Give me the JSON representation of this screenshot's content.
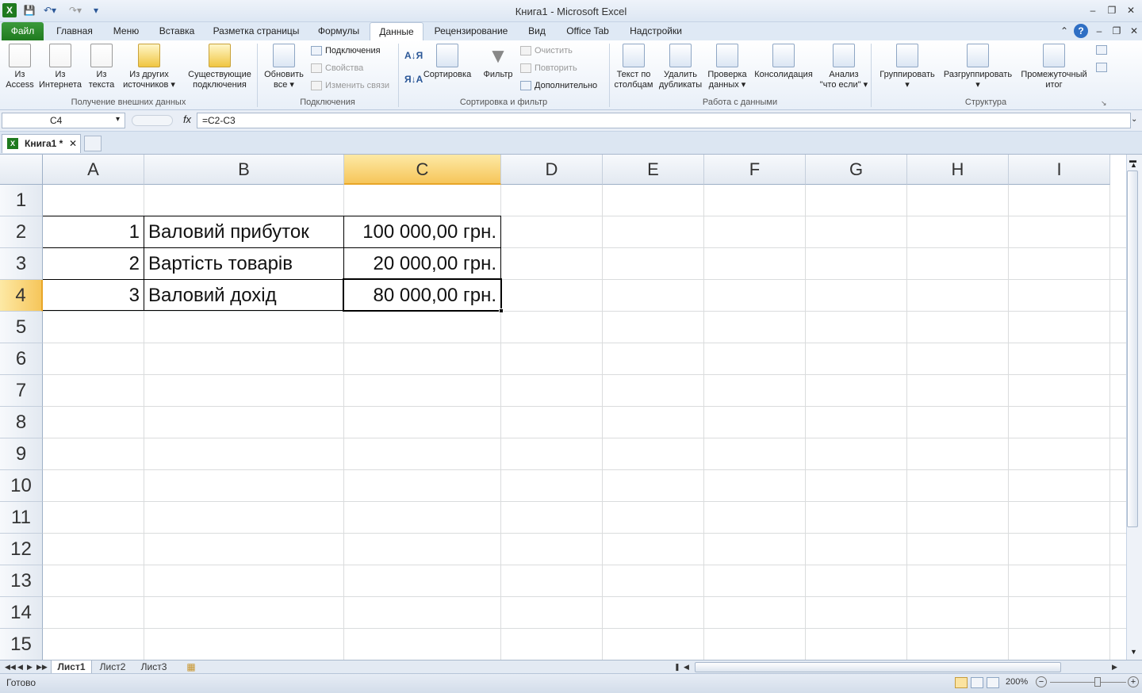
{
  "window": {
    "title": "Книга1  -  Microsoft Excel"
  },
  "ribbon_tabs": [
    "Файл",
    "Главная",
    "Меню",
    "Вставка",
    "Разметка страницы",
    "Формулы",
    "Данные",
    "Рецензирование",
    "Вид",
    "Office Tab",
    "Надстройки"
  ],
  "ribbon": {
    "get_external": {
      "label": "Получение внешних данных",
      "from_access": [
        "Из",
        "Access"
      ],
      "from_web": [
        "Из",
        "Интернета"
      ],
      "from_text": [
        "Из",
        "текста"
      ],
      "from_other": [
        "Из других",
        "источников"
      ],
      "existing": [
        "Существующие",
        "подключения"
      ]
    },
    "connections": {
      "label": "Подключения",
      "refresh": [
        "Обновить",
        "все"
      ],
      "connections_btn": "Подключения",
      "properties": "Свойства",
      "edit_links": "Изменить связи"
    },
    "sort_filter": {
      "label": "Сортировка и фильтр",
      "sort": "Сортировка",
      "filter": "Фильтр",
      "clear": "Очистить",
      "reapply": "Повторить",
      "advanced": "Дополнительно"
    },
    "data_tools": {
      "label": "Работа с данными",
      "text_to_cols": [
        "Текст по",
        "столбцам"
      ],
      "remove_dup": [
        "Удалить",
        "дубликаты"
      ],
      "validation": [
        "Проверка",
        "данных"
      ],
      "consolidate": "Консолидация",
      "what_if": [
        "Анализ",
        "\"что если\""
      ]
    },
    "outline": {
      "label": "Структура",
      "group": "Группировать",
      "ungroup": "Разгруппировать",
      "subtotal": [
        "Промежуточный",
        "итог"
      ]
    }
  },
  "formula_bar": {
    "name_box": "C4",
    "fx": "fx",
    "formula": "=C2-C3"
  },
  "doc_tab": {
    "label": "Книга1 *"
  },
  "columns": [
    "A",
    "B",
    "C",
    "D",
    "E",
    "F",
    "G",
    "H",
    "I"
  ],
  "rows": [
    "1",
    "2",
    "3",
    "4",
    "5",
    "6",
    "7",
    "8",
    "9",
    "10",
    "11",
    "12",
    "13",
    "14",
    "15"
  ],
  "cells": {
    "A2": "1",
    "B2": "Валовий прибуток",
    "C2": "100 000,00 грн.",
    "A3": "2",
    "B3": "Вартість товарів",
    "C3": "20 000,00 грн.",
    "A4": "3",
    "B4": "Валовий дохід",
    "C4": "80 000,00 грн."
  },
  "sheets": [
    "Лист1",
    "Лист2",
    "Лист3"
  ],
  "status": {
    "text": "Готово",
    "zoom": "200%"
  },
  "colors": {
    "selected_header": "#f6c65b",
    "file_tab": "#1f7a1f"
  }
}
